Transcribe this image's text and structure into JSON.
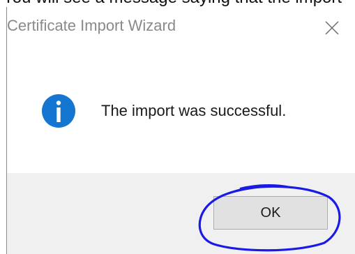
{
  "caption": {
    "text": "You will see a message saying that the import"
  },
  "dialog": {
    "title": "Certificate Import Wizard",
    "close_glyph": "✕",
    "message": "The import was successful.",
    "icon": "information-icon",
    "ok_label": "OK"
  },
  "colors": {
    "info_icon_blue": "#1476d1",
    "footer_bg": "#f0f0f0",
    "button_bg": "#e1e1e1",
    "annotation_ring": "#1a1ae6"
  }
}
